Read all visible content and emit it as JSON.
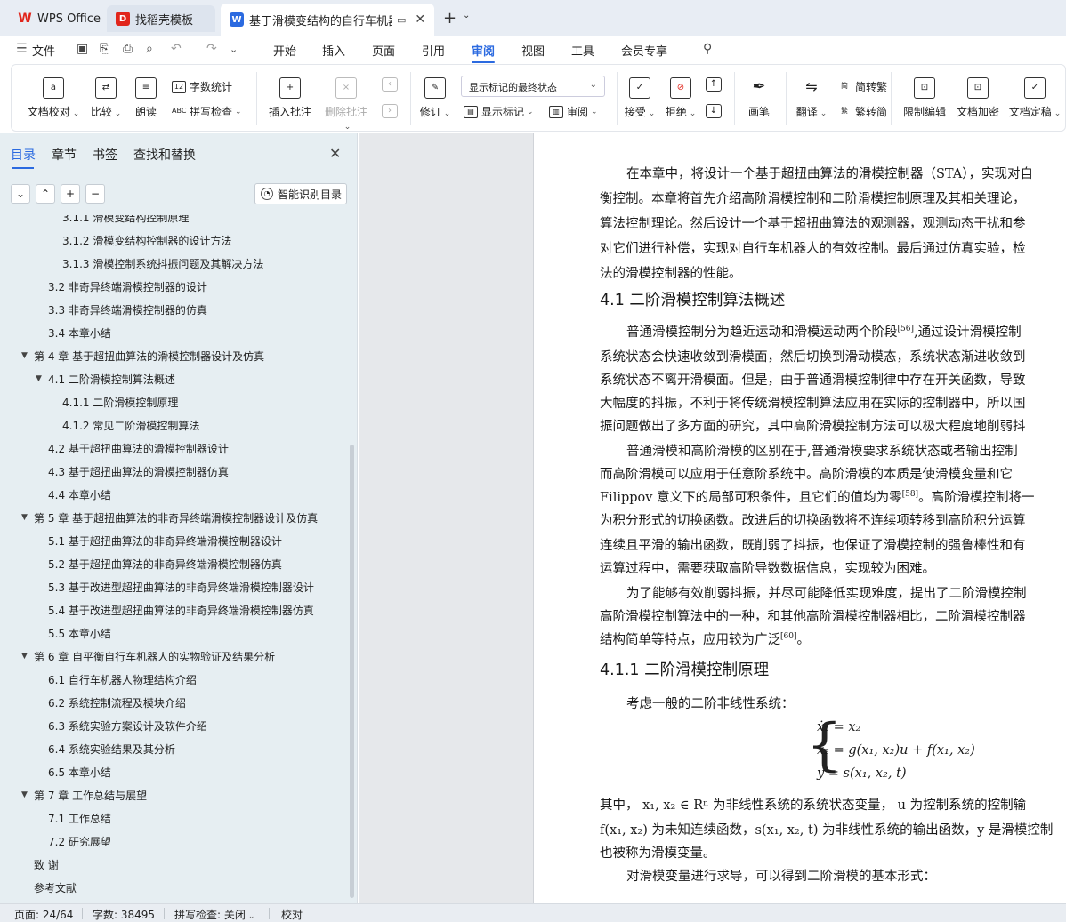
{
  "titlebar": {
    "tabs": [
      {
        "label": "WPS Office",
        "icon": "wps-logo-icon"
      },
      {
        "label": "找稻壳模板",
        "icon": "docer-icon"
      },
      {
        "label": "基于滑模变结构的自行车机器人",
        "icon": "word-doc-icon"
      }
    ],
    "new_tab_glyph": "+",
    "menu_caret": "⌄"
  },
  "menubar": {
    "file": "文件",
    "items": [
      "开始",
      "插入",
      "页面",
      "引用",
      "审阅",
      "视图",
      "工具",
      "会员专享"
    ],
    "active": "审阅"
  },
  "ribbon": {
    "doc_proof": "文档校对",
    "compare": "比较",
    "read_aloud": "朗读",
    "word_count": "字数统计",
    "spell_check": "拼写检查",
    "insert_comment": "插入批注",
    "delete_comment": "删除批注",
    "revise": "修订",
    "markup_state": "显示标记的最终状态",
    "show_markup": "显示标记",
    "review_pane": "审阅",
    "accept": "接受",
    "reject": "拒绝",
    "pen": "画笔",
    "translate": "翻译",
    "to_traditional": "简转繁",
    "to_simplified": "繁转简",
    "restrict_edit": "限制编辑",
    "encrypt": "文档加密",
    "finalize": "文档定稿"
  },
  "nav": {
    "tabs": [
      "目录",
      "章节",
      "书签",
      "查找和替换"
    ],
    "active_tab": "目录",
    "buttons": {
      "collapse": "⌄",
      "expand": "⌃",
      "add": "+",
      "remove": "−"
    },
    "smart_toc": "智能识别目录",
    "toc": [
      {
        "level": 3,
        "text": "3.1.1 滑模变结构控制原理",
        "arrow": ""
      },
      {
        "level": 3,
        "text": "3.1.2  滑模变结构控制器的设计方法",
        "arrow": ""
      },
      {
        "level": 3,
        "text": "3.1.3 滑模控制系统抖振问题及其解决方法",
        "arrow": ""
      },
      {
        "level": 2,
        "text": "3.2  非奇异终端滑模控制器的设计",
        "arrow": ""
      },
      {
        "level": 2,
        "text": "3.3  非奇异终端滑模控制器的仿真",
        "arrow": ""
      },
      {
        "level": 2,
        "text": "3.4  本章小结",
        "arrow": ""
      },
      {
        "level": 1,
        "text": "第 4 章  基于超扭曲算法的滑模控制器设计及仿真",
        "arrow": "▼"
      },
      {
        "level": 2,
        "text": "4.1  二阶滑模控制算法概述",
        "arrow": "▼"
      },
      {
        "level": 3,
        "text": "4.1.1  二阶滑模控制原理",
        "arrow": ""
      },
      {
        "level": 3,
        "text": "4.1.2  常见二阶滑模控制算法",
        "arrow": ""
      },
      {
        "level": 2,
        "text": "4.2  基于超扭曲算法的滑模控制器设计",
        "arrow": ""
      },
      {
        "level": 2,
        "text": "4.3  基于超扭曲算法的滑模控制器仿真",
        "arrow": ""
      },
      {
        "level": 2,
        "text": "4.4  本章小结",
        "arrow": ""
      },
      {
        "level": 1,
        "text": "第 5 章  基于超扭曲算法的非奇异终端滑模控制器设计及仿真",
        "arrow": "▼"
      },
      {
        "level": 2,
        "text": "5.1  基于超扭曲算法的非奇异终端滑模控制器设计",
        "arrow": ""
      },
      {
        "level": 2,
        "text": "5.2  基于超扭曲算法的非奇异终端滑模控制器仿真",
        "arrow": ""
      },
      {
        "level": 2,
        "text": "5.3  基于改进型超扭曲算法的非奇异终端滑模控制器设计",
        "arrow": ""
      },
      {
        "level": 2,
        "text": "5.4  基于改进型超扭曲算法的非奇异终端滑模控制器仿真",
        "arrow": ""
      },
      {
        "level": 2,
        "text": "5.5  本章小结",
        "arrow": ""
      },
      {
        "level": 1,
        "text": "第 6 章  自平衡自行车机器人的实物验证及结果分析",
        "arrow": "▼"
      },
      {
        "level": 2,
        "text": "6.1  自行车机器人物理结构介绍",
        "arrow": ""
      },
      {
        "level": 2,
        "text": "6.2  系统控制流程及模块介绍",
        "arrow": ""
      },
      {
        "level": 2,
        "text": "6.3  系统实验方案设计及软件介绍",
        "arrow": ""
      },
      {
        "level": 2,
        "text": "6.4  系统实验结果及其分析",
        "arrow": ""
      },
      {
        "level": 2,
        "text": "6.5  本章小结",
        "arrow": ""
      },
      {
        "level": 1,
        "text": "第 7 章  工作总结与展望",
        "arrow": "▼"
      },
      {
        "level": 2,
        "text": "7.1  工作总结",
        "arrow": ""
      },
      {
        "level": 2,
        "text": "7.2  研究展望",
        "arrow": ""
      },
      {
        "level": 1,
        "text": "致  谢",
        "arrow": ""
      },
      {
        "level": 1,
        "text": "参考文献",
        "arrow": ""
      }
    ]
  },
  "document": {
    "p1": [
      "在本章中，将设计一个基于超扭曲算法的滑模控制器（STA），实现对自",
      "衡控制。本章将首先介绍高阶滑模控制和二阶滑模控制原理及其相关理论，",
      "算法控制理论。然后设计一个基于超扭曲算法的观测器，观测动态干扰和参",
      "对它们进行补偿，实现对自行车机器人的有效控制。最后通过仿真实验，检",
      "法的滑模控制器的性能。"
    ],
    "h41": "4.1  二阶滑模控制算法概述",
    "p2": [
      "普通滑模控制分为趋近运动和滑模运动两个阶段",
      "系统状态会快速收敛到滑模面，然后切换到滑动模态，系统状态渐进收敛到",
      "系统状态不离开滑模面。但是，由于普通滑模控制律中存在开关函数，导致",
      "大幅度的抖振，不利于将传统滑模控制算法应用在实际的控制器中，所以国",
      "振问题做出了多方面的研究，其中高阶滑模控制方法可以极大程度地削弱抖"
    ],
    "p2_ref": "[56]",
    "p2_tail": ",通过设计滑模控制",
    "p3": [
      "普通滑模和高阶滑模的区别在于,普通滑模要求系统状态或者输出控制",
      "而高阶滑模可以应用于任意阶系统中。高阶滑模的本质是使滑模变量和它",
      "Filippov 意义下的局部可积条件，且它们的值均为零",
      "为积分形式的切换函数。改进后的切换函数将不连续项转移到高阶积分运算",
      "连续且平滑的输出函数，既削弱了抖振，也保证了滑模控制的强鲁棒性和有",
      "运算过程中，需要获取高阶导数数据信息，实现较为困难。"
    ],
    "p3_ref": "[58]",
    "p3_tail": "。高阶滑模控制将一",
    "p4": [
      "为了能够有效削弱抖振，并尽可能降低实现难度，提出了二阶滑模控制",
      "高阶滑模控制算法中的一种，和其他高阶滑模控制器相比，二阶滑模控制器",
      "结构简单等特点，应用较为广泛"
    ],
    "p4_ref": "[60]",
    "p4_tail": "。",
    "h411": "4.1.1  二阶滑模控制原理",
    "p5": "考虑一般的二阶非线性系统：",
    "eq": [
      "ẋ₁ = x₂",
      "ẋ₂ = g(x₁, x₂)u + f(x₁, x₂)",
      "y = s(x₁, x₂, t)"
    ],
    "p6": [
      "其中，  x₁, x₂ ∈ Rⁿ 为非线性系统的系统状态变量，  u 为控制系统的控制输",
      "f(x₁, x₂) 为未知连续函数，s(x₁, x₂, t) 为非线性系统的输出函数，y 是滑模控制",
      "也被称为滑模变量。"
    ],
    "p7": "对滑模变量进行求导，可以得到二阶滑模的基本形式："
  },
  "status": {
    "page": "页面: 24/64",
    "words": "字数: 38495",
    "spell": "拼写检查: 关闭",
    "proof": "校对"
  }
}
